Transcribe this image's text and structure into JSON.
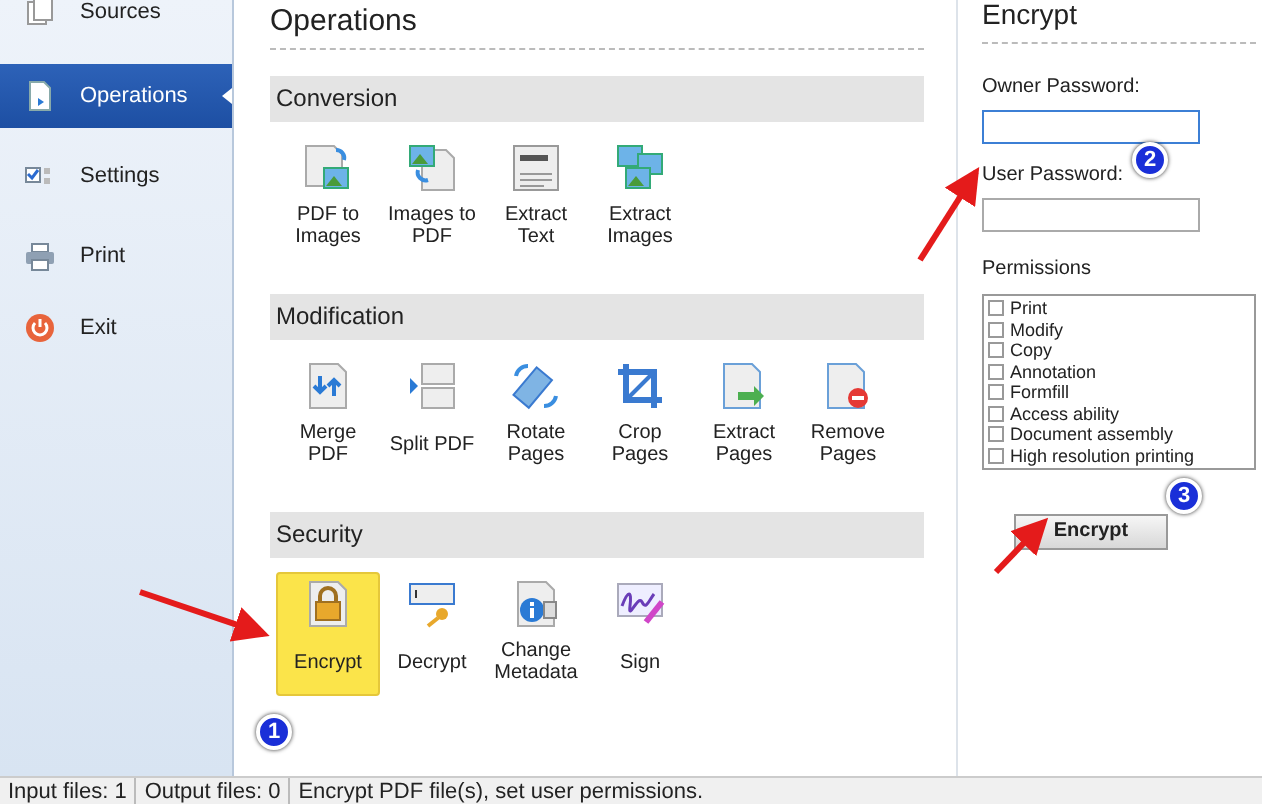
{
  "sidebar": {
    "items": [
      {
        "label": "Sources",
        "selected": false
      },
      {
        "label": "Operations",
        "selected": true
      },
      {
        "label": "Settings",
        "selected": false
      },
      {
        "label": "Print",
        "selected": false
      },
      {
        "label": "Exit",
        "selected": false
      }
    ]
  },
  "operations": {
    "title": "Operations",
    "sections": [
      {
        "title": "Conversion",
        "items": [
          {
            "label": "PDF to Images",
            "selected": false
          },
          {
            "label": "Images to PDF",
            "selected": false
          },
          {
            "label": "Extract Text",
            "selected": false
          },
          {
            "label": "Extract Images",
            "selected": false
          }
        ]
      },
      {
        "title": "Modification",
        "items": [
          {
            "label": "Merge PDF",
            "selected": false
          },
          {
            "label": "Split PDF",
            "selected": false
          },
          {
            "label": "Rotate Pages",
            "selected": false
          },
          {
            "label": "Crop Pages",
            "selected": false
          },
          {
            "label": "Extract Pages",
            "selected": false
          },
          {
            "label": "Remove Pages",
            "selected": false
          }
        ]
      },
      {
        "title": "Security",
        "items": [
          {
            "label": "Encrypt",
            "selected": true
          },
          {
            "label": "Decrypt",
            "selected": false
          },
          {
            "label": "Change Metadata",
            "selected": false
          },
          {
            "label": "Sign",
            "selected": false
          }
        ]
      }
    ]
  },
  "encrypt_panel": {
    "title": "Encrypt",
    "fields": [
      {
        "label": "Owner Password:",
        "focused": true
      },
      {
        "label": "User Password:",
        "focused": false
      }
    ],
    "permissions_label": "Permissions",
    "permissions": [
      {
        "label": "Print",
        "checked": false
      },
      {
        "label": "Modify",
        "checked": false
      },
      {
        "label": "Copy",
        "checked": false
      },
      {
        "label": "Annotation",
        "checked": false
      },
      {
        "label": "Formfill",
        "checked": false
      },
      {
        "label": "Access ability",
        "checked": false
      },
      {
        "label": "Document assembly",
        "checked": false
      },
      {
        "label": "High resolution printing",
        "checked": false
      }
    ],
    "button": "Encrypt"
  },
  "annotations": [
    {
      "label": "1"
    },
    {
      "label": "2"
    },
    {
      "label": "3"
    }
  ],
  "status_bar": [
    "Input files: 1",
    "Output files: 0",
    "Encrypt PDF file(s), set user permissions."
  ]
}
